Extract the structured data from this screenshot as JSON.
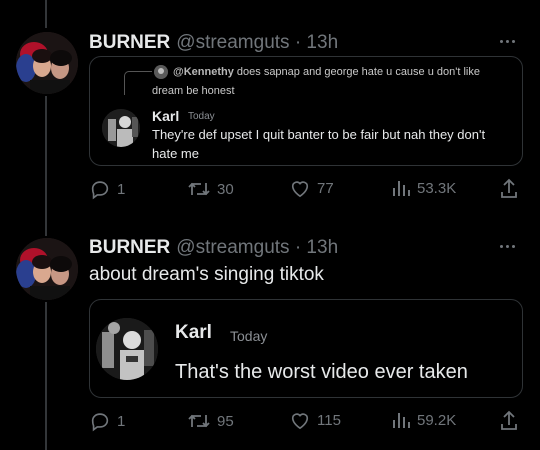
{
  "tweets": [
    {
      "author": "BURNER",
      "handle": "@streamguts · 13h",
      "text": "",
      "quote": {
        "reply_to_user": "@Kennethy",
        "reply_to_text_line1": "does sapnap and george hate u cause u don't like",
        "reply_to_text_line2": "dream be honest",
        "name": "Karl",
        "time": "Today",
        "message_line1": "They're def upset I quit banter to be fair but nah they don't",
        "message_line2": "hate me"
      },
      "stats": {
        "replies": "1",
        "retweets": "30",
        "likes": "77",
        "views": "53.3K"
      }
    },
    {
      "author": "BURNER",
      "handle": "@streamguts · 13h",
      "text": "about dream's singing tiktok",
      "quote": {
        "name": "Karl",
        "time": "Today",
        "message_line1": "That's the worst video ever taken"
      },
      "stats": {
        "replies": "1",
        "retweets": "95",
        "likes": "115",
        "views": "59.2K"
      }
    }
  ],
  "icons": [
    "reply-icon",
    "retweet-icon",
    "like-icon",
    "views-icon",
    "share-icon",
    "more-icon"
  ],
  "colors": {
    "background": "#000000",
    "text": "#e7e9ea",
    "muted": "#71767b",
    "border": "#2f3336"
  }
}
